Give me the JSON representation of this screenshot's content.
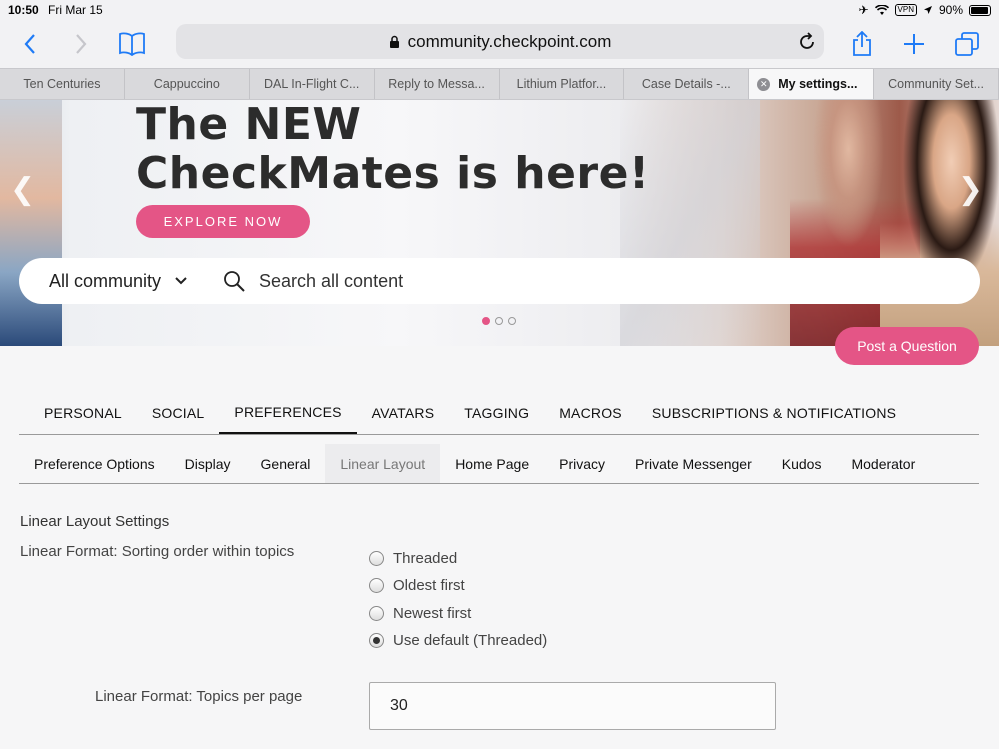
{
  "status": {
    "time": "10:50",
    "date": "Fri Mar 15",
    "vpn": "VPN",
    "battery": "90%"
  },
  "browser": {
    "url": "community.checkpoint.com",
    "tabs": [
      {
        "label": "Ten Centuries",
        "active": false
      },
      {
        "label": "Cappuccino",
        "active": false
      },
      {
        "label": "DAL In-Flight C...",
        "active": false
      },
      {
        "label": "Reply to Messa...",
        "active": false
      },
      {
        "label": "Lithium Platfor...",
        "active": false
      },
      {
        "label": "Case Details -...",
        "active": false
      },
      {
        "label": "My settings...",
        "active": true
      },
      {
        "label": "Community Set...",
        "active": false
      }
    ]
  },
  "hero": {
    "headline_line1": "The NEW",
    "headline_line2": "CheckMates is here!",
    "cta": "EXPLORE NOW",
    "scope": "All community",
    "search_placeholder": "Search all content",
    "post_question": "Post a Question"
  },
  "nav": {
    "tabs": [
      "PERSONAL",
      "SOCIAL",
      "PREFERENCES",
      "AVATARS",
      "TAGGING",
      "MACROS",
      "SUBSCRIPTIONS & NOTIFICATIONS"
    ],
    "active": "PREFERENCES"
  },
  "subnav": {
    "tabs": [
      "Preference Options",
      "Display",
      "General",
      "Linear Layout",
      "Home Page",
      "Privacy",
      "Private Messenger",
      "Kudos",
      "Moderator"
    ],
    "active": "Linear Layout"
  },
  "settings": {
    "section_title": "Linear Layout Settings",
    "sort_label": "Linear Format: Sorting order within topics",
    "sort_options": [
      "Threaded",
      "Oldest first",
      "Newest first",
      "Use default (Threaded)"
    ],
    "sort_selected": 3,
    "topics_label": "Linear Format: Topics per page",
    "topics_value": "30"
  },
  "colors": {
    "accent": "#e45586",
    "link": "#1f7bf6"
  }
}
